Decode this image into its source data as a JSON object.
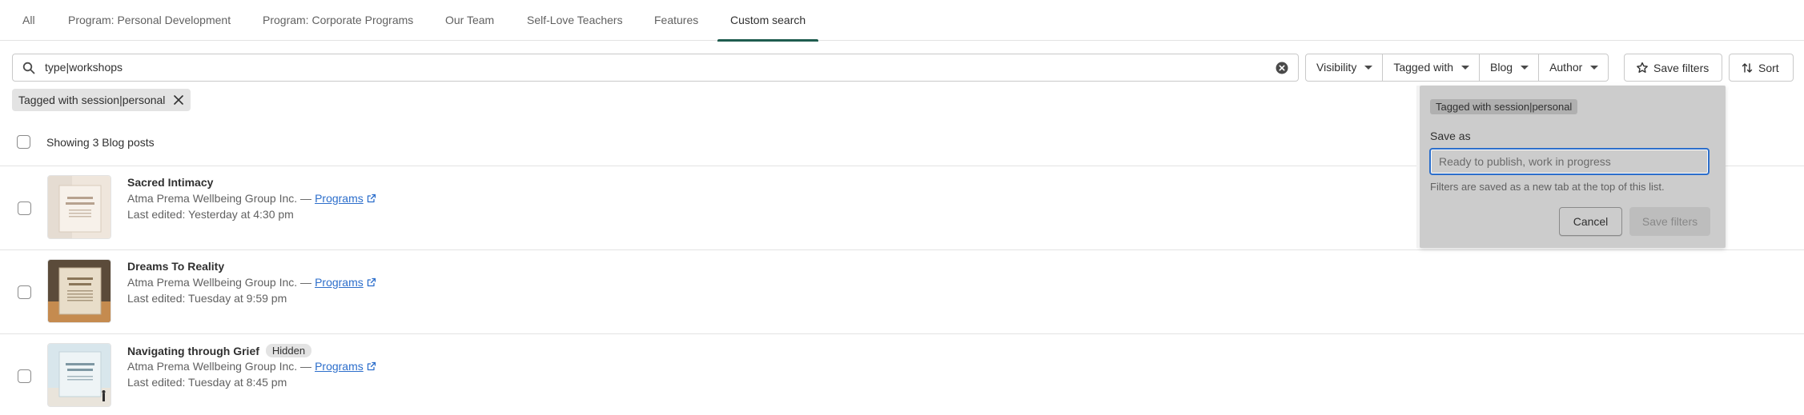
{
  "tabs": [
    {
      "label": "All",
      "active": false
    },
    {
      "label": "Program: Personal Development",
      "active": false
    },
    {
      "label": "Program: Corporate Programs",
      "active": false
    },
    {
      "label": "Our Team",
      "active": false
    },
    {
      "label": "Self-Love Teachers",
      "active": false
    },
    {
      "label": "Features",
      "active": false
    },
    {
      "label": "Custom search",
      "active": true
    }
  ],
  "search": {
    "value": "type|workshops",
    "icon": "search-icon",
    "clear_icon": "circle-x-icon"
  },
  "filters": [
    {
      "label": "Visibility"
    },
    {
      "label": "Tagged with"
    },
    {
      "label": "Blog"
    },
    {
      "label": "Author"
    }
  ],
  "save_filters_label": "Save filters",
  "sort_label": "Sort",
  "applied_filter": "Tagged with session|personal",
  "list": {
    "showing": "Showing 3 Blog posts"
  },
  "posts": [
    {
      "title": "Sacred Intimacy",
      "badge": "",
      "company": "Atma Prema Wellbeing Group Inc. —",
      "blog": "Programs",
      "edited": "Last edited: Yesterday at 4:30 pm"
    },
    {
      "title": "Dreams To Reality",
      "badge": "",
      "company": "Atma Prema Wellbeing Group Inc. —",
      "blog": "Programs",
      "edited": "Last edited: Tuesday at 9:59 pm"
    },
    {
      "title": "Navigating through Grief",
      "badge": "Hidden",
      "company": "Atma Prema Wellbeing Group Inc. —",
      "blog": "Programs",
      "edited": "Last edited: Tuesday at 8:45 pm"
    }
  ],
  "popover": {
    "chip": "Tagged with session|personal",
    "label": "Save as",
    "placeholder": "Ready to publish, work in progress",
    "help": "Filters are saved as a new tab at the top of this list.",
    "cancel": "Cancel",
    "save": "Save filters"
  },
  "colors": {
    "active_tab_underline": "#1f5c4f",
    "link": "#2c6ecb",
    "focus_ring": "#2c6ecb"
  }
}
